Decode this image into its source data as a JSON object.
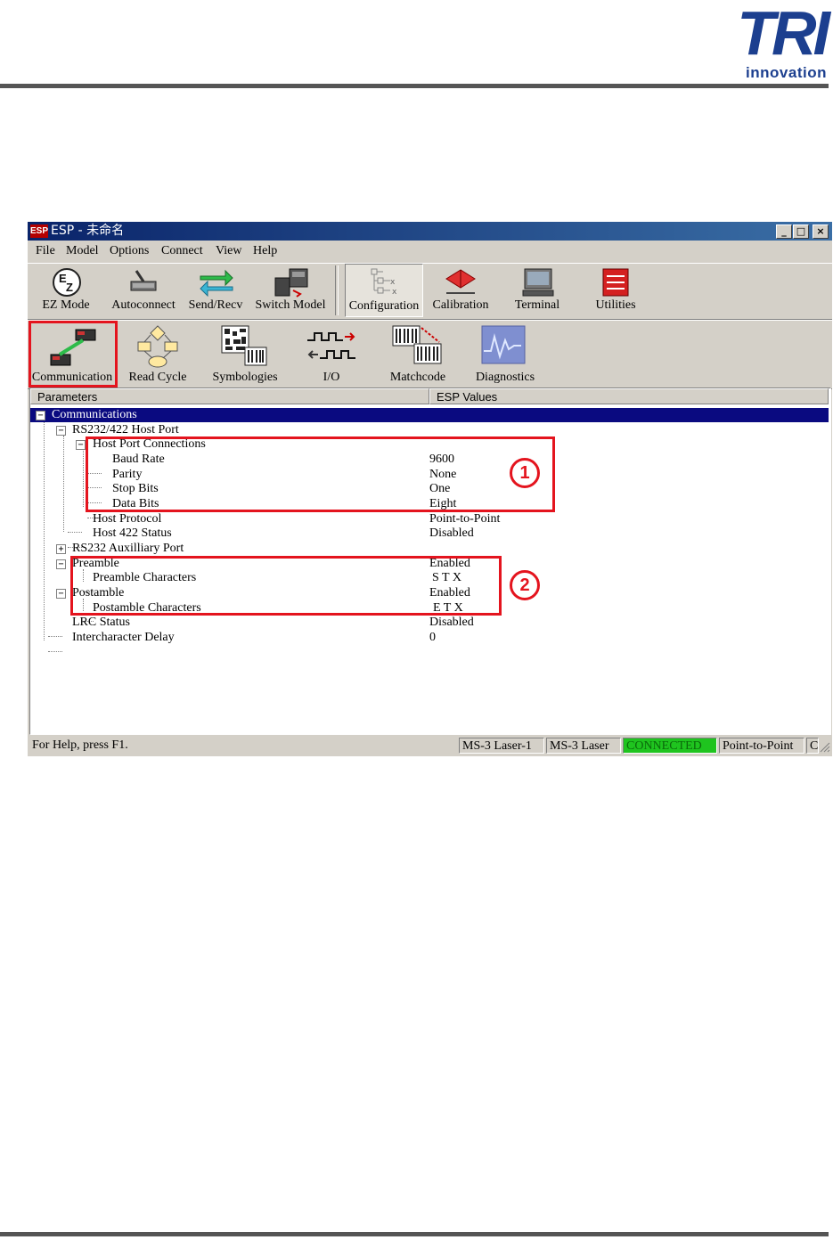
{
  "brand": {
    "logo_main": "TRI",
    "logo_sub": "innovation",
    "color": "#1c3f8f"
  },
  "window": {
    "title": "ESP - 未命名",
    "icon_text": "ESP",
    "controls": [
      "_",
      "□",
      "×"
    ]
  },
  "menu": [
    {
      "label": "File"
    },
    {
      "label": "Model"
    },
    {
      "label": "Options"
    },
    {
      "label": "Connect"
    },
    {
      "label": "View"
    },
    {
      "label": "Help"
    }
  ],
  "toolbar_top": [
    {
      "label": "EZ Mode",
      "icon": "ez-mode-icon"
    },
    {
      "label": "Autoconnect",
      "icon": "autoconnect-icon"
    },
    {
      "label": "Send/Recv",
      "icon": "send-recv-icon"
    },
    {
      "label": "Switch Model",
      "icon": "switch-model-icon"
    },
    {
      "label": "Configuration",
      "icon": "configuration-icon",
      "pressed": true
    },
    {
      "label": "Calibration",
      "icon": "calibration-icon"
    },
    {
      "label": "Terminal",
      "icon": "terminal-icon"
    },
    {
      "label": "Utilities",
      "icon": "utilities-icon"
    }
  ],
  "toolbar_config": [
    {
      "label": "Communication",
      "icon": "communication-icon",
      "highlighted": true
    },
    {
      "label": "Read Cycle",
      "icon": "read-cycle-icon"
    },
    {
      "label": "Symbologies",
      "icon": "symbologies-icon"
    },
    {
      "label": "I/O",
      "icon": "io-icon"
    },
    {
      "label": "Matchcode",
      "icon": "matchcode-icon"
    },
    {
      "label": "Diagnostics",
      "icon": "diagnostics-icon"
    }
  ],
  "table": {
    "col_parameters": "Parameters",
    "col_values": "ESP Values",
    "rows": [
      {
        "name": "Communications",
        "value": "",
        "level": 0,
        "expander": "−",
        "selected": true
      },
      {
        "name": "RS232/422 Host Port",
        "value": "",
        "level": 1,
        "expander": "−"
      },
      {
        "name": "Host Port Connections",
        "value": "",
        "level": 2,
        "expander": "−"
      },
      {
        "name": "Baud Rate",
        "value": "9600",
        "level": 3
      },
      {
        "name": "Parity",
        "value": "None",
        "level": 3
      },
      {
        "name": "Stop Bits",
        "value": "One",
        "level": 3
      },
      {
        "name": "Data Bits",
        "value": "Eight",
        "level": 3
      },
      {
        "name": "Host Protocol",
        "value": "Point-to-Point",
        "level": 2
      },
      {
        "name": "Host 422 Status",
        "value": "Disabled",
        "level": 2
      },
      {
        "name": "RS232 Auxilliary Port",
        "value": "",
        "level": 1,
        "expander": "+"
      },
      {
        "name": "Preamble",
        "value": "Enabled",
        "level": 1,
        "expander": "−"
      },
      {
        "name": "Preamble Characters",
        "value": "S  T  X",
        "level": 2
      },
      {
        "name": "Postamble",
        "value": "Enabled",
        "level": 1,
        "expander": "−"
      },
      {
        "name": "Postamble Characters",
        "value": "E  T  X",
        "level": 2
      },
      {
        "name": "LRC Status",
        "value": "Disabled",
        "level": 1
      },
      {
        "name": "Intercharacter Delay",
        "value": "0",
        "level": 1
      }
    ]
  },
  "callouts": [
    {
      "number": "1"
    },
    {
      "number": "2"
    }
  ],
  "status": {
    "help": "For Help, press F1.",
    "model1": "MS-3 Laser-1",
    "model2": "MS-3 Laser",
    "connection": "CONNECTED",
    "protocol": "Point-to-Point",
    "extra": "C"
  },
  "colors": {
    "highlight": "#e4141e",
    "selection": "#0a0a80",
    "connected": "#1fc41f"
  }
}
